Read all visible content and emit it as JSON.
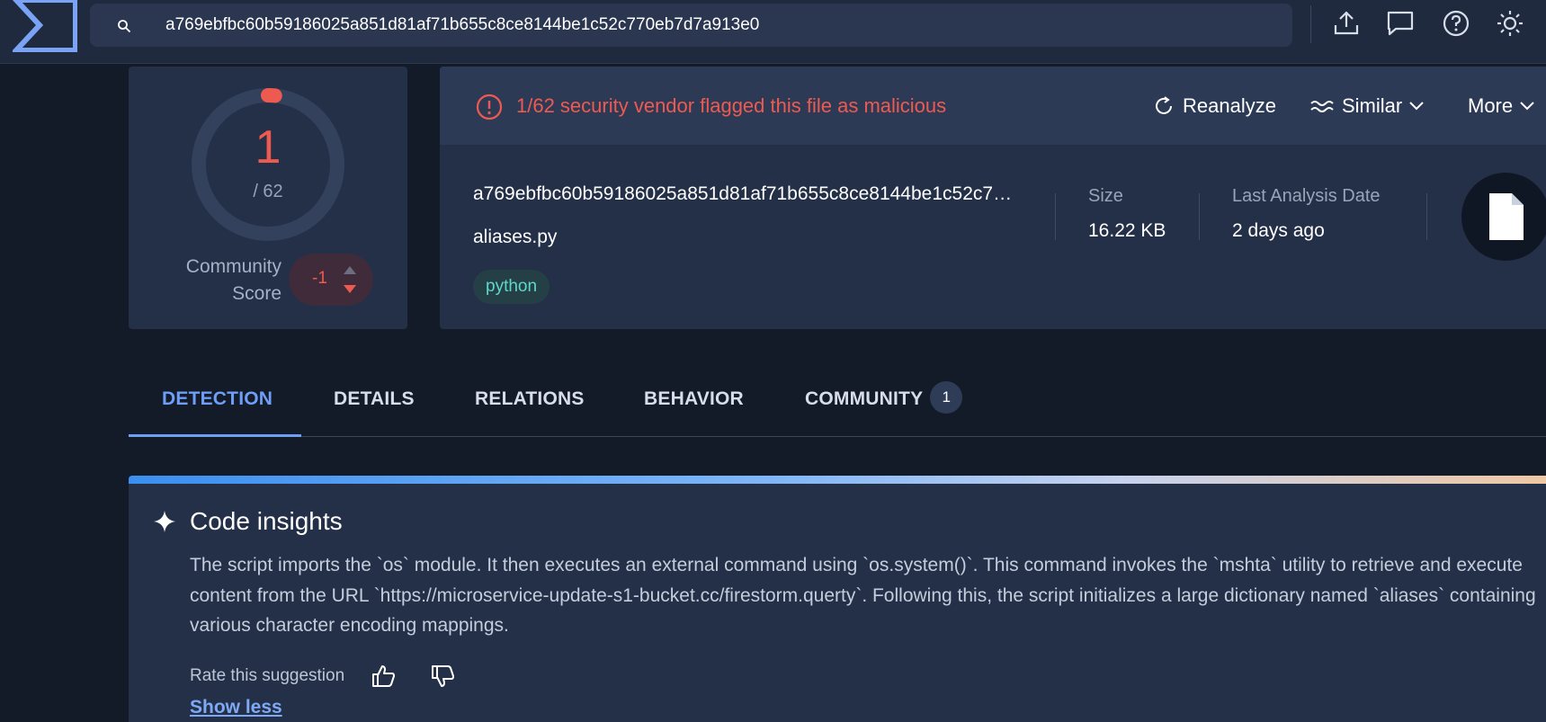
{
  "search": {
    "query": "a769ebfbc60b59186025a851d81af71b655c8ce8144be1c52c770eb7d7a913e0"
  },
  "topbar": {
    "icons": [
      "upload-icon",
      "chat-icon",
      "help-icon",
      "theme-icon"
    ]
  },
  "score": {
    "positives": "1",
    "total": "/ 62",
    "community_label": "Community Score",
    "community_value": "-1",
    "detection_ratio": 0.016
  },
  "banner": {
    "alert_text": "1/62 security vendor flagged this file as malicious",
    "reanalyze_label": "Reanalyze",
    "similar_label": "Similar",
    "more_label": "More"
  },
  "file": {
    "hash": "a769ebfbc60b59186025a851d81af71b655c8ce8144be1c52c770eb7d7a913e0",
    "name": "aliases.py",
    "tag": "python",
    "size_label": "Size",
    "size_value": "16.22 KB",
    "date_label": "Last Analysis Date",
    "date_value": "2 days ago"
  },
  "tabs": [
    {
      "label": "DETECTION",
      "active": true
    },
    {
      "label": "DETAILS"
    },
    {
      "label": "RELATIONS"
    },
    {
      "label": "BEHAVIOR"
    },
    {
      "label": "COMMUNITY",
      "badge": "1"
    }
  ],
  "insights": {
    "title": "Code insights",
    "body": "The script imports the `os` module. It then executes an external command using `os.system()`. This command invokes the `mshta` utility to retrieve and execute content from the URL `https://microservice-update-s1-bucket.cc/firestorm.querty`. Following this, the script initializes a large dictionary named `aliases` containing various character encoding mappings.",
    "rate_label": "Rate this suggestion",
    "show_less_label": "Show less"
  },
  "colors": {
    "malicious": "#ef5a50",
    "accent": "#6f9ef7",
    "tag_text": "#5fd9c7"
  }
}
